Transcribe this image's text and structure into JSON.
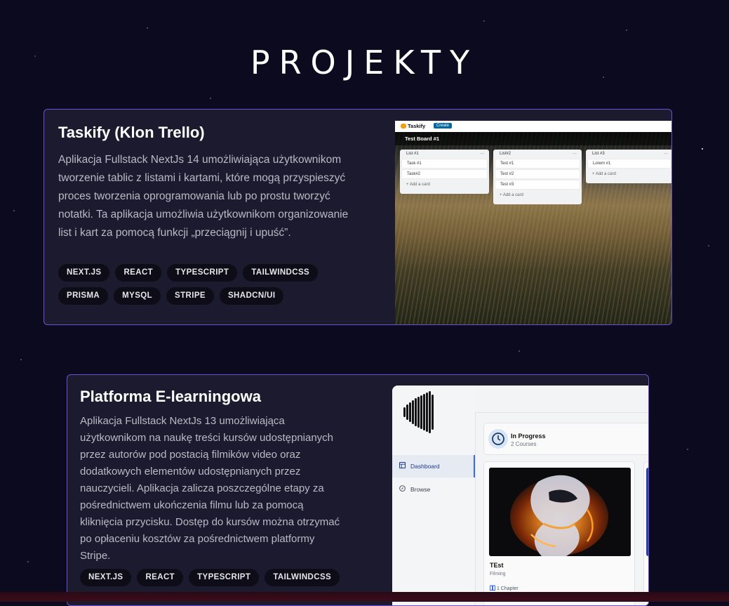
{
  "page": {
    "title": "PROJEKTY"
  },
  "projects": [
    {
      "title": "Taskify (Klon Trello)",
      "description": "Aplikacja Fullstack NextJs 14 umożliwiająca użytkownikom tworzenie tablic z listami i kartami, które mogą przyspieszyć proces tworzenia oprogramowania lub po prostu tworzyć notatki. Ta aplikacja umożliwia użytkownikom organizowanie list i kart za pomocą funkcji „przeciągnij i upuść”.",
      "tags": [
        "NEXT.JS",
        "REACT",
        "TYPESCRIPT",
        "TAILWINDCSS",
        "PRISMA",
        "MYSQL",
        "STRIPE",
        "SHADCN/UI"
      ],
      "screenshot": {
        "logo": "Taskify",
        "create_label": "Create",
        "board_title": "Test Board #1",
        "lists": [
          {
            "title": "List #1",
            "menu": "···",
            "cards": [
              "Task #1",
              "Task#2"
            ],
            "add": "+  Add a card"
          },
          {
            "title": "List#2",
            "menu": "···",
            "cards": [
              "Test #1",
              "Test #2",
              "Test #3"
            ],
            "add": "+  Add a card"
          },
          {
            "title": "List #3",
            "menu": "···",
            "cards": [
              "Lorem #1"
            ],
            "add": "+  Add a card"
          }
        ]
      }
    },
    {
      "title": "Platforma E-learningowa",
      "description": "Aplikacja Fullstack NextJs 13 umożliwiająca użytkownikom na naukę treści kursów udostępnianych przez autorów pod postacią filmików video oraz dodatkowych elementów udostępnianych przez nauczycieli. Aplikacja zalicza poszczególne etapy za pośrednictwem ukończenia filmu lub za pomocą kliknięcia przycisku. Dostęp do kursów można otrzymać po opłaceniu kosztów za pośrednictwem platformy Stripe.",
      "tags": [
        "NEXT.JS",
        "REACT",
        "TYPESCRIPT",
        "TAILWINDCSS"
      ],
      "screenshot": {
        "nav": [
          "Dashboard",
          "Browse"
        ],
        "progress_title": "In Progress",
        "progress_sub": "2 Courses",
        "course_title": "TEst",
        "course_category": "Filming",
        "course_chapters": "1 Chapter"
      }
    }
  ],
  "colors": {
    "background": "#0b0a1e",
    "card": "#1c1a2e",
    "card_border": "#6e4fd1",
    "tag_bg": "#0d0c17"
  }
}
